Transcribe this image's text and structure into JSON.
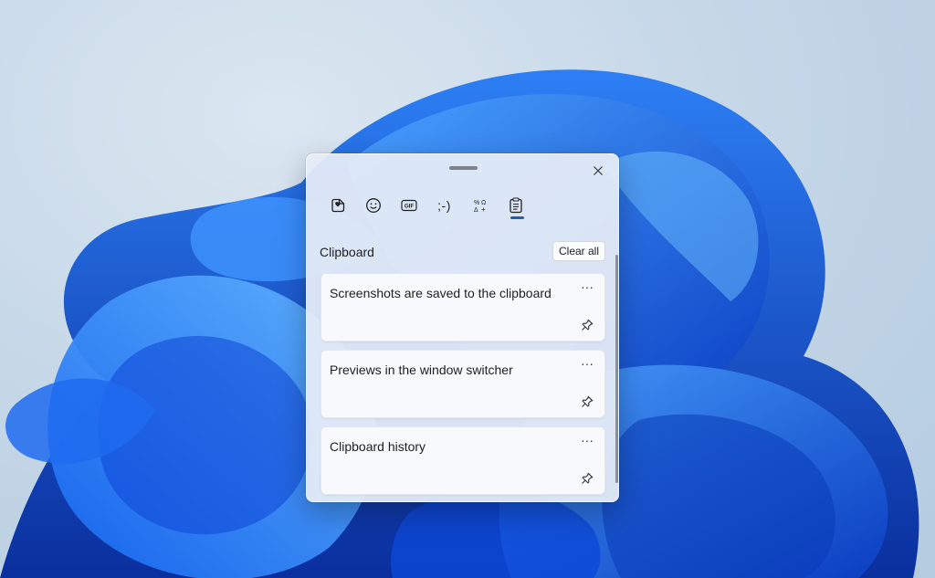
{
  "background": {
    "wallpaper": "windows-11-bloom",
    "accent": "#1a62b3"
  },
  "panel": {
    "title": "Clipboard",
    "clear_all_label": "Clear all",
    "tabs": [
      {
        "name": "recently-used",
        "icon": "heart-sticker-icon",
        "active": false
      },
      {
        "name": "emoji",
        "icon": "smiley-icon",
        "active": false
      },
      {
        "name": "gif",
        "icon": "gif-icon",
        "active": false
      },
      {
        "name": "kaomoji",
        "icon": ";-)",
        "active": false
      },
      {
        "name": "symbols",
        "icon": "symbols-icon",
        "active": false
      },
      {
        "name": "clipboard",
        "icon": "clipboard-icon",
        "active": true
      }
    ],
    "kaomoji_glyph": ";-)",
    "items": [
      {
        "text": "Screenshots are saved to the clipboard",
        "more": "···"
      },
      {
        "text": "Previews in the window switcher",
        "more": "···"
      },
      {
        "text": "Clipboard history",
        "more": "···"
      }
    ]
  }
}
